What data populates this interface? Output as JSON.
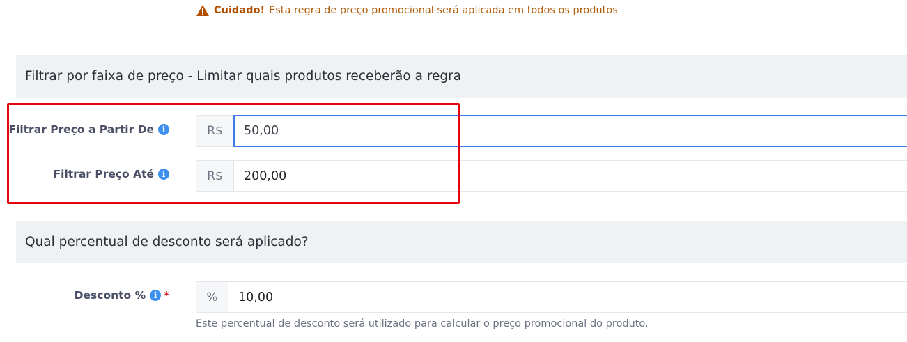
{
  "warning": {
    "title": "Cuidado!",
    "message": "Esta regra de preço promocional será aplicada em todos os produtos",
    "color": "#b25d0a"
  },
  "sections": {
    "price_filter_title": "Filtrar por faixa de preço - Limitar quais produtos receberão a regra",
    "discount_title": "Qual percentual de desconto será aplicado?"
  },
  "fields": {
    "price_from": {
      "label": "Filtrar Preço a Partir De",
      "prefix": "R$",
      "value": "50,00"
    },
    "price_to": {
      "label": "Filtrar Preço Até",
      "prefix": "R$",
      "value": "200,00"
    },
    "discount": {
      "label": "Desconto %",
      "required_mark": "*",
      "prefix": "%",
      "value": "10,00",
      "help": "Este percentual de desconto será utilizado para calcular o preço promocional do produto."
    }
  },
  "icons": {
    "info": "i"
  },
  "colors": {
    "accent": "#3f7be8",
    "highlight": "#e3060e",
    "section_bg": "#eff2f5",
    "info_icon": "#3d8ff0"
  }
}
